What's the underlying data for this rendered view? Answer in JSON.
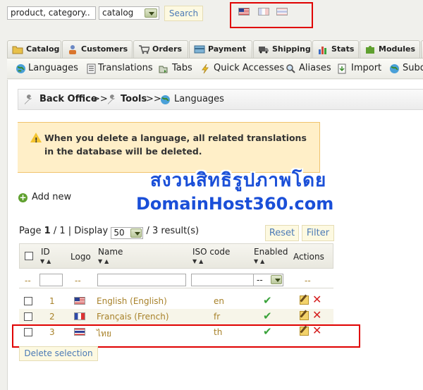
{
  "search": {
    "value": "product, category..",
    "scope": "catalog",
    "button": "Search"
  },
  "tabs": [
    {
      "label": "Catalog",
      "icon": "folder-icon"
    },
    {
      "label": "Customers",
      "icon": "customers-icon"
    },
    {
      "label": "Orders",
      "icon": "cart-icon"
    },
    {
      "label": "Payment",
      "icon": "payment-icon"
    },
    {
      "label": "Shipping",
      "icon": "truck-icon"
    },
    {
      "label": "Stats",
      "icon": "chart-icon"
    },
    {
      "label": "Modules",
      "icon": "puzzle-icon"
    }
  ],
  "subtabs": [
    {
      "label": "Languages",
      "icon": "globe-icon"
    },
    {
      "label": "Translations",
      "icon": "document-icon"
    },
    {
      "label": "Tabs",
      "icon": "tabs-icon"
    },
    {
      "label": "Quick Accesses",
      "icon": "lightning-icon"
    },
    {
      "label": "Aliases",
      "icon": "magnifier-icon"
    },
    {
      "label": "Import",
      "icon": "import-icon"
    },
    {
      "label": "Subd",
      "icon": "globe-icon"
    }
  ],
  "breadcrumb": {
    "root": "Back Office",
    "sep": ">>",
    "tools": "Tools",
    "current": "Languages"
  },
  "warning": "When you delete a language, all related translations in the database will be deleted.",
  "watermark": {
    "thai": "สงวนสิทธิรูปภาพโดย",
    "domain": "DomainHost360.com"
  },
  "add_new": "Add new",
  "pager": {
    "page_label": "Page",
    "page": "1",
    "pages": "/ 1",
    "display_label": "| Display",
    "per_page": "50",
    "results": "/ 3 result(s)"
  },
  "buttons": {
    "reset": "Reset",
    "filter": "Filter",
    "delete_selection": "Delete selection"
  },
  "table": {
    "headers": {
      "id": "ID",
      "logo": "Logo",
      "name": "Name",
      "iso": "ISO code",
      "enabled": "Enabled",
      "actions": "Actions"
    },
    "filter": {
      "dash": "--",
      "enabled_value": "--"
    },
    "rows": [
      {
        "id": "1",
        "flag": "flag-us-icon",
        "name": "English (English)",
        "iso": "en",
        "enabled": "✔"
      },
      {
        "id": "2",
        "flag": "flag-fr-icon",
        "name": "Français (French)",
        "iso": "fr",
        "enabled": "✔"
      },
      {
        "id": "3",
        "flag": "flag-th-icon",
        "name": "ไทย",
        "iso": "th",
        "enabled": "✔"
      }
    ]
  },
  "colors": {
    "highlight_red": "#e00000",
    "watermark_blue": "#1a4fd8",
    "warning_bg": "#ffefc8"
  }
}
